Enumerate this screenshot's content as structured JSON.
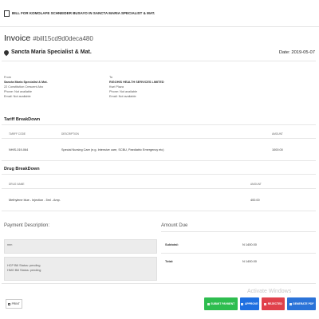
{
  "window": {
    "title": "BILL FOR KOMOLAFE SCHNEIDER BUSAYO IN SANCTA MARIA SPECIALIST & MAT."
  },
  "invoice": {
    "label": "Invoice",
    "code": "#bill15cd9d0deca480",
    "organization": "Sancta Maria Specialist & Mat.",
    "date": "Date: 2019-05-07"
  },
  "from": {
    "heading": "From",
    "name": "Sancta Maria Specialist & Mat.",
    "address": "22 Constitution Crescent Abo",
    "phone": "Phone: Not available",
    "email": "Email: Not available"
  },
  "to": {
    "heading": "To",
    "name": "RIGOHIS HEALTH SERVICES LIMITED",
    "address": "Kwri Plaza",
    "phone": "Phone: Not available",
    "email": "Email: Not available"
  },
  "tariff": {
    "title": "Tariff BreakDown",
    "columns": [
      "TARIFF CODE",
      "DESCRIPTION",
      "AMOUNT"
    ],
    "rows": [
      {
        "code": "NHIS-019-064",
        "description": "Special Nursing Care (e.g. Intensive care, SCBU, Paediatric Emergency etc)",
        "amount": "1000.00"
      }
    ]
  },
  "drug": {
    "title": "Drug BreakDown",
    "columns": [
      "DRUG NAME",
      "AMOUNT"
    ],
    "rows": [
      {
        "name": "Methylene blue - Injection - 5ml - Amp.",
        "amount": "400.00"
      }
    ]
  },
  "payment": {
    "title": "Payment Description:",
    "value": "nnn",
    "hcp_status": "HCP Bill Status: pending",
    "hmo_status": "HMO Bill Status: pending"
  },
  "amount_due": {
    "title": "Amount Due",
    "subtotal_label": "Subtotal:",
    "subtotal_value": "N 1400.00",
    "total_label": "Total:",
    "total_value": "N 1400.00"
  },
  "buttons": {
    "print": "PRINT",
    "submit": "SUBMIT PAYMENT",
    "approve": "APPROVE",
    "reject": "REJECTED",
    "generate": "GENERATE PDF"
  },
  "watermark": "Activate Windows",
  "colors": {
    "submit": "#2ebd4f",
    "approve": "#1f6fe0",
    "reject": "#e0414b",
    "generate": "#2b73d8"
  }
}
